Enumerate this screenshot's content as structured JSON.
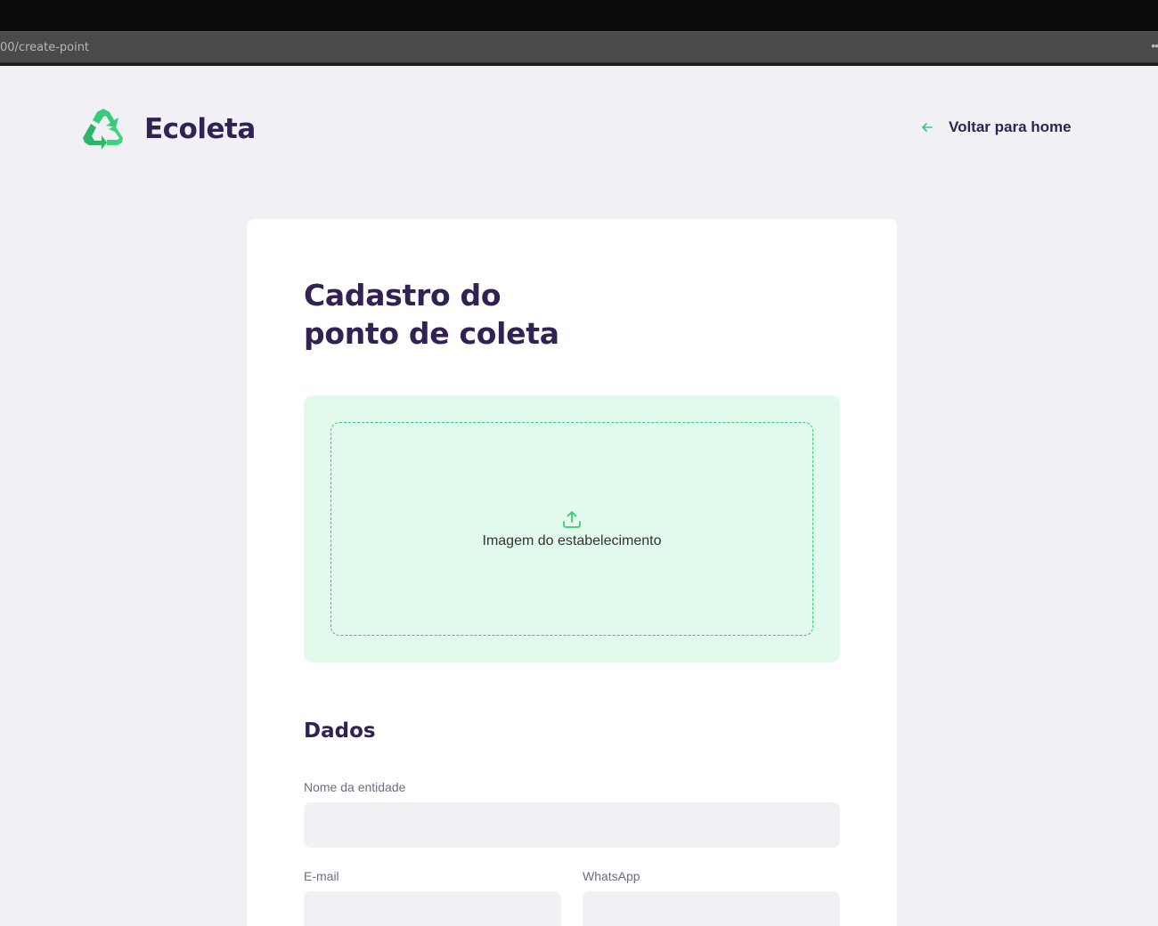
{
  "browser": {
    "url": "00/create-point",
    "menu_glyph": "••"
  },
  "header": {
    "logo_text": "Ecoleta",
    "logo_icon": "recycle-icon",
    "back_link_label": "Voltar para home",
    "back_link_icon": "arrow-left-icon"
  },
  "form": {
    "title_line1": "Cadastro do",
    "title_line2": "ponto de coleta",
    "dropzone": {
      "label": "Imagem do estabelecimento",
      "icon": "upload-icon"
    },
    "section_title": "Dados",
    "fields": {
      "name": {
        "label": "Nome da entidade",
        "value": ""
      },
      "email": {
        "label": "E-mail",
        "value": ""
      },
      "whatsapp": {
        "label": "WhatsApp",
        "value": ""
      }
    }
  },
  "colors": {
    "brand_dark": "#322153",
    "brand_green": "#34cb79",
    "background": "#f0f0f5",
    "dropzone_bg": "#e1faec",
    "label_gray": "#6c6c80"
  }
}
